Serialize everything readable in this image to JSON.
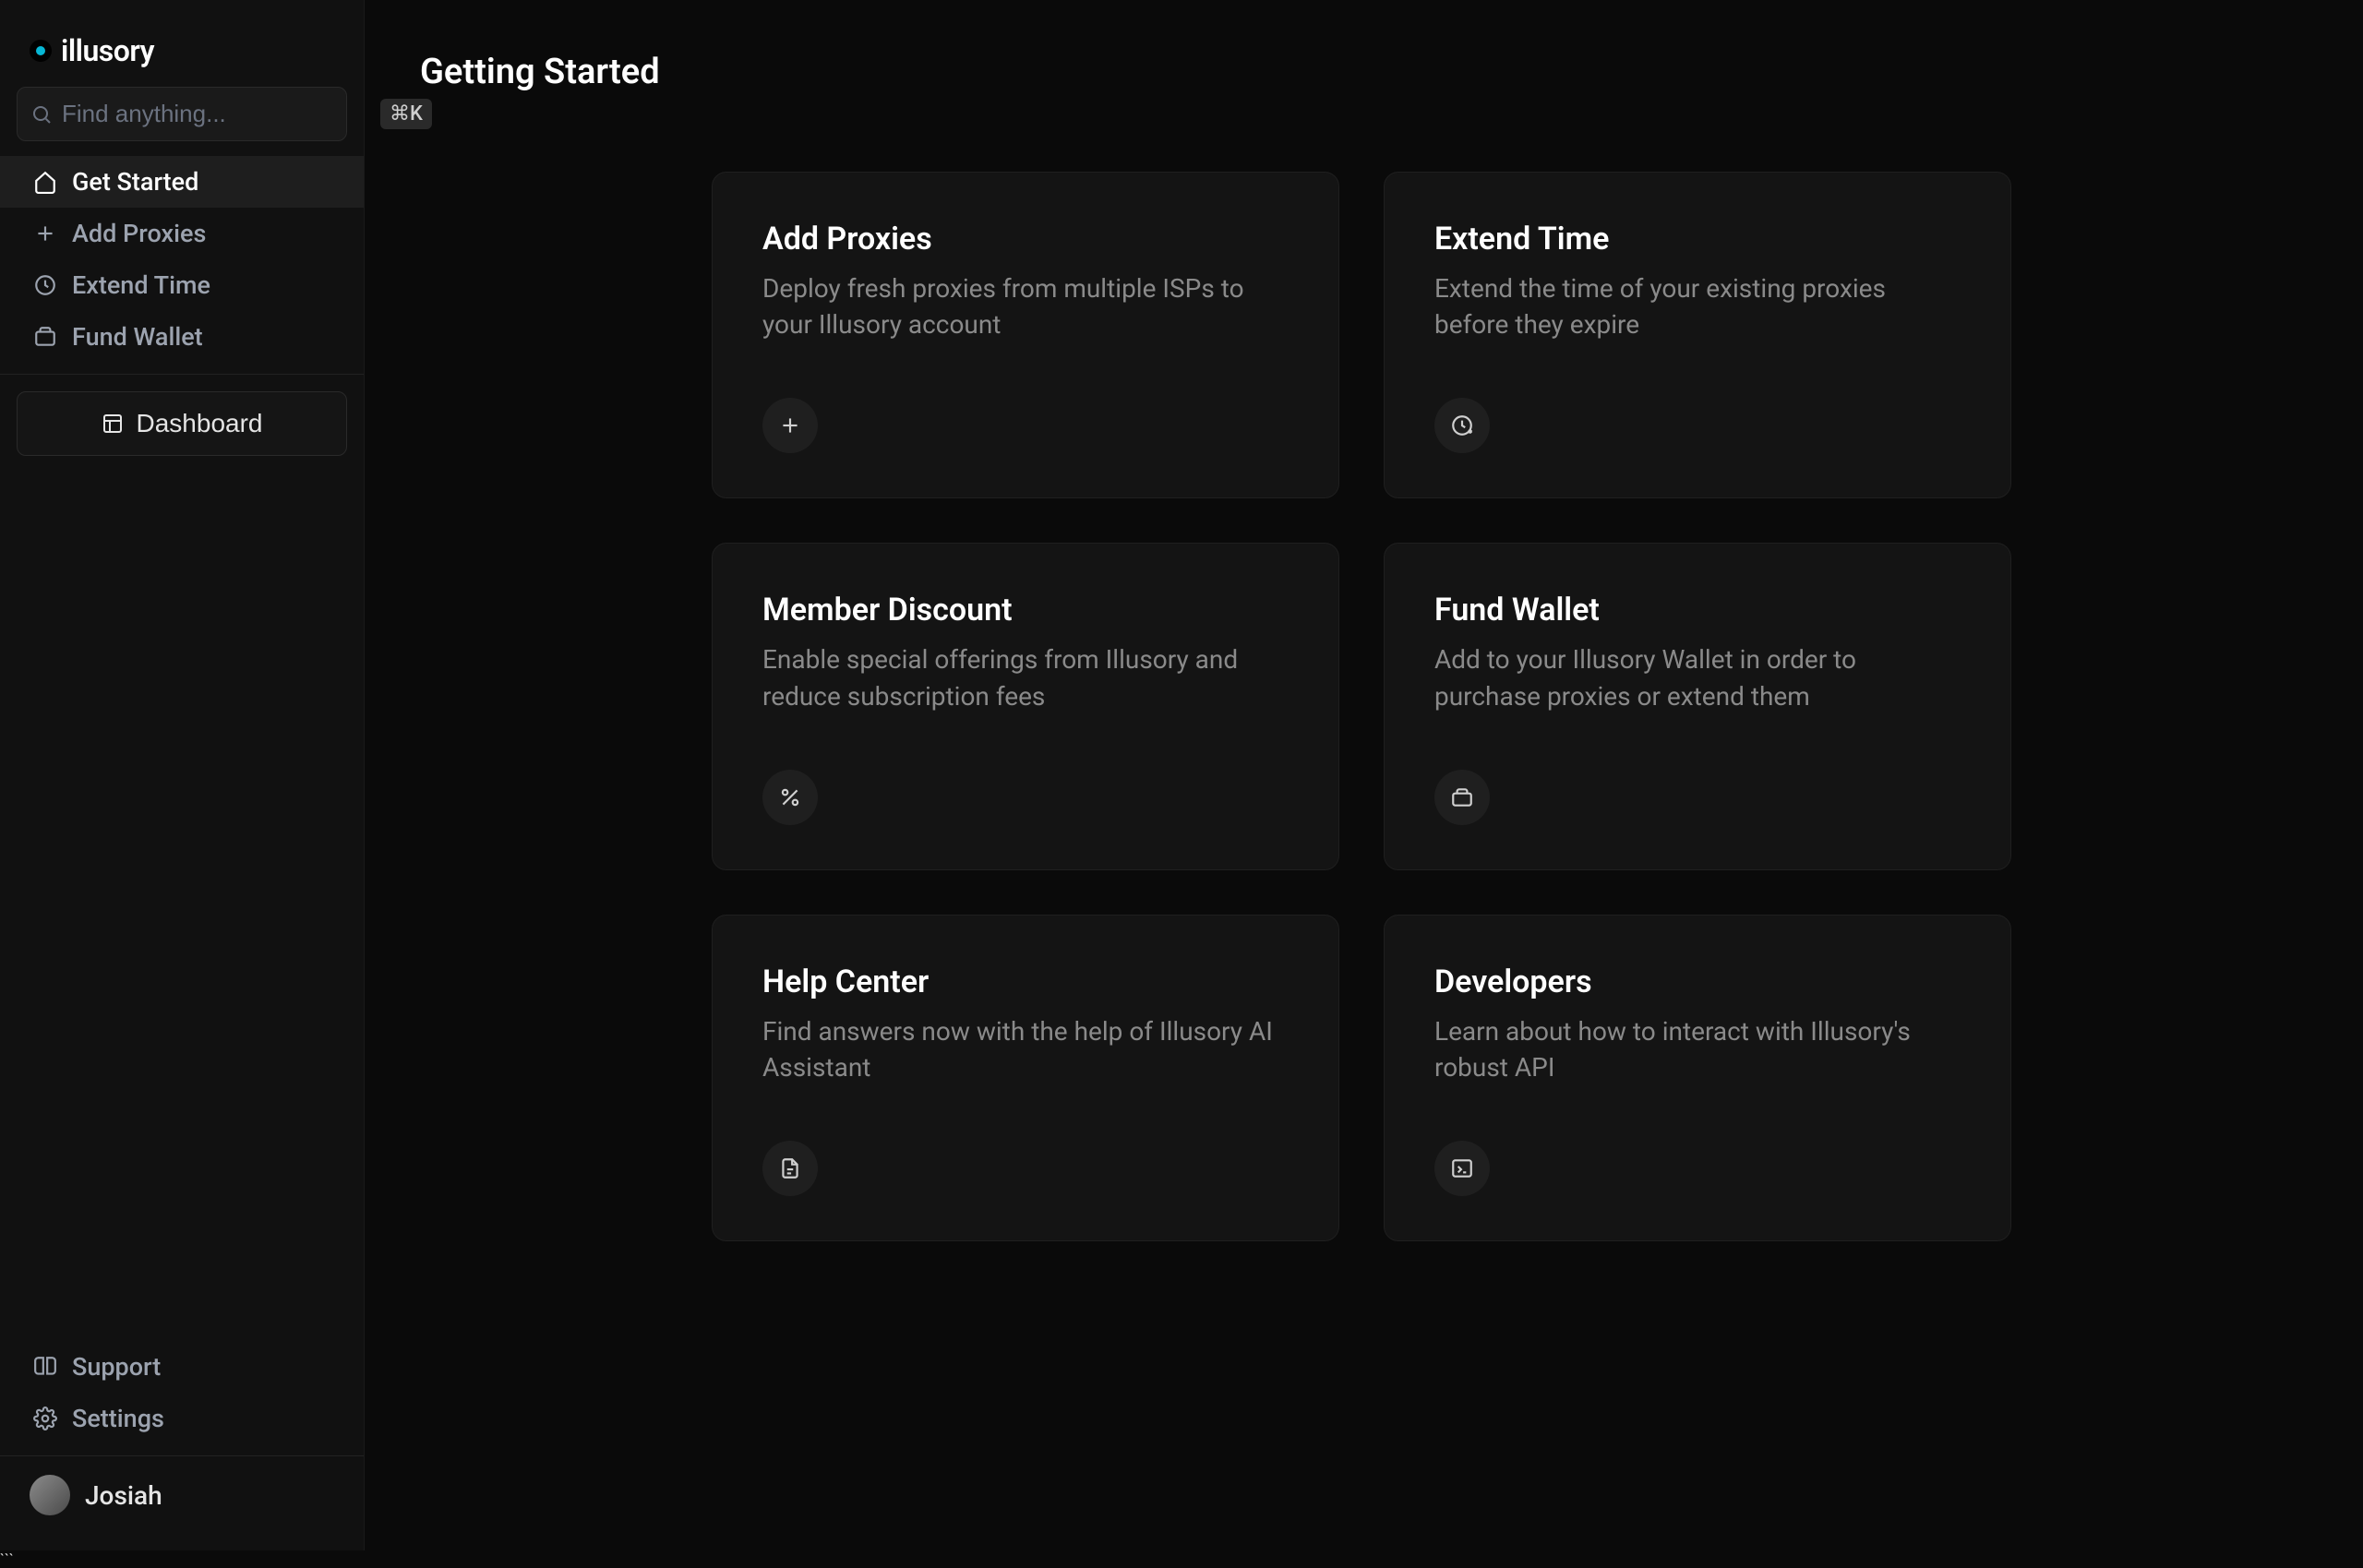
{
  "brand": {
    "name": "illusory"
  },
  "search": {
    "placeholder": "Find anything...",
    "shortcut": "⌘K"
  },
  "sidebar": {
    "items": [
      {
        "label": "Get Started",
        "icon": "home"
      },
      {
        "label": "Add Proxies",
        "icon": "plus"
      },
      {
        "label": "Extend Time",
        "icon": "clock"
      },
      {
        "label": "Fund Wallet",
        "icon": "wallet"
      }
    ],
    "dashboard_label": "Dashboard",
    "footer": [
      {
        "label": "Support",
        "icon": "book"
      },
      {
        "label": "Settings",
        "icon": "gear"
      }
    ]
  },
  "user": {
    "name": "Josiah"
  },
  "page": {
    "title": "Getting Started"
  },
  "cards": [
    {
      "title": "Add Proxies",
      "desc": "Deploy fresh proxies from multiple ISPs to your Illusory account",
      "icon": "plus"
    },
    {
      "title": "Extend Time",
      "desc": "Extend the time of your existing proxies before they expire",
      "icon": "clock-plus"
    },
    {
      "title": "Member Discount",
      "desc": "Enable special offerings from Illusory and reduce subscription fees",
      "icon": "percent"
    },
    {
      "title": "Fund Wallet",
      "desc": "Add to your Illusory Wallet in order to purchase proxies or extend them",
      "icon": "wallet"
    },
    {
      "title": "Help Center",
      "desc": "Find answers now with the help of Illusory AI Assistant",
      "icon": "doc"
    },
    {
      "title": "Developers",
      "desc": "Learn about how to interact with Illusory's robust API",
      "icon": "terminal"
    }
  ]
}
